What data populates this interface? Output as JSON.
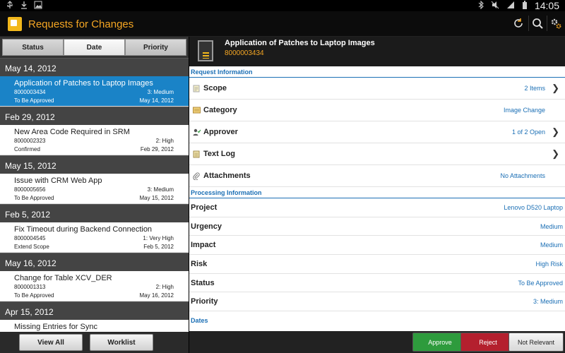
{
  "status_bar": {
    "time": "14:05",
    "left_icons": [
      "usb-icon",
      "download-icon",
      "image-icon"
    ],
    "right_icons": [
      "bluetooth-icon",
      "mute-icon",
      "signal-icon",
      "battery-icon"
    ]
  },
  "action_bar": {
    "title": "Requests for Changes",
    "actions": [
      "refresh-icon",
      "search-icon",
      "settings-icon"
    ]
  },
  "sort_tabs": [
    {
      "label": "Status",
      "active": false
    },
    {
      "label": "Date",
      "active": true
    },
    {
      "label": "Priority",
      "active": false
    }
  ],
  "list_groups": [
    {
      "date": "May 14, 2012",
      "items": [
        {
          "title": "Application of Patches to Laptop Images",
          "id": "8000003434",
          "priority": "3: Medium",
          "status": "To Be Approved",
          "date": "May 14, 2012",
          "selected": true
        }
      ]
    },
    {
      "date": "Feb 29, 2012",
      "items": [
        {
          "title": "New Area Code Required in SRM",
          "id": "8000002323",
          "priority": "2: High",
          "status": "Confirmed",
          "date": "Feb 29, 2012",
          "selected": false
        }
      ]
    },
    {
      "date": "May 15, 2012",
      "items": [
        {
          "title": "Issue with CRM Web App",
          "id": "8000005656",
          "priority": "3: Medium",
          "status": "To Be Approved",
          "date": "May 15, 2012",
          "selected": false
        }
      ]
    },
    {
      "date": "Feb 5, 2012",
      "items": [
        {
          "title": "Fix Timeout during Backend Connection",
          "id": "8000004545",
          "priority": "1: Very High",
          "status": "Extend Scope",
          "date": "Feb 5, 2012",
          "selected": false
        }
      ]
    },
    {
      "date": "May 16, 2012",
      "items": [
        {
          "title": "Change for Table XCV_DER",
          "id": "8000001313",
          "priority": "2: High",
          "status": "To Be Approved",
          "date": "May 16, 2012",
          "selected": false
        }
      ]
    },
    {
      "date": "Apr 15, 2012",
      "items": [
        {
          "title": "Missing Entries for Sync",
          "id": "",
          "priority": "",
          "status": "",
          "date": "",
          "selected": false
        }
      ]
    }
  ],
  "list_footer": {
    "view_all": "View All",
    "worklist": "Worklist"
  },
  "detail": {
    "title": "Application of Patches to Laptop Images",
    "id": "8000003434",
    "request_section": "Request Information",
    "request_rows": [
      {
        "label": "Scope",
        "value": "2 Items",
        "icon": "scope-icon",
        "chevron": true
      },
      {
        "label": "Category",
        "value": "Image Change",
        "icon": "category-icon",
        "chevron": false
      },
      {
        "label": "Approver",
        "value": "1 of 2 Open",
        "icon": "approver-icon",
        "chevron": true
      },
      {
        "label": "Text Log",
        "value": "",
        "icon": "text-log-icon",
        "chevron": true
      },
      {
        "label": "Attachments",
        "value": "No Attachments",
        "icon": "attachment-icon",
        "chevron": false
      }
    ],
    "processing_section": "Processing Information",
    "processing_rows": [
      {
        "label": "Project",
        "value": "Lenovo D520 Laptop"
      },
      {
        "label": "Urgency",
        "value": "Medium"
      },
      {
        "label": "Impact",
        "value": "Medium"
      },
      {
        "label": "Risk",
        "value": "High Risk"
      },
      {
        "label": "Status",
        "value": "To Be Approved"
      },
      {
        "label": "Priority",
        "value": "3: Medium"
      }
    ],
    "dates_section": "Dates",
    "actions": {
      "approve": "Approve",
      "reject": "Reject",
      "not_relevant": "Not Relevant"
    }
  },
  "colors": {
    "accent_orange": "#f5a623",
    "selected_blue": "#1a83c7",
    "link_blue": "#1b6fb5",
    "approve_green": "#2e9b3d",
    "reject_red": "#b4202e"
  }
}
